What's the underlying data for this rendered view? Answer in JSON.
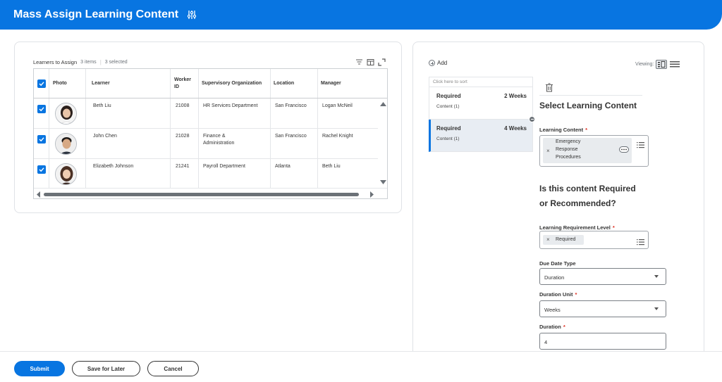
{
  "header": {
    "title": "Mass Assign Learning Content",
    "icon": "settings-sliders-icon"
  },
  "learners": {
    "title": "Learners to Assign",
    "count": "3 items",
    "selected": "3 selected",
    "columns": [
      "Photo",
      "Learner",
      "Worker ID",
      "Supervisory Organization",
      "Location",
      "Manager"
    ],
    "column_worker_line1": "Worker",
    "column_worker_line2": "ID",
    "rows": [
      {
        "learner": "Beth Liu",
        "worker_id": "21008",
        "org": "HR Services Department",
        "org2": "",
        "location": "San Francisco",
        "manager": "Logan McNeil"
      },
      {
        "learner": "John Chen",
        "worker_id": "21028",
        "org": "Finance &",
        "org2": "Administration",
        "location": "San Francisco",
        "manager": "Rachel Knight"
      },
      {
        "learner": "Elizabeth Johnson",
        "worker_id": "21241",
        "org": "Payroll Department",
        "org2": "",
        "location": "Atlanta",
        "manager": "Beth Liu"
      }
    ]
  },
  "content_list": {
    "add_label": "Add",
    "viewing_label": "Viewing:",
    "sort_hint": "Click here to sort",
    "items": [
      {
        "level": "Required",
        "duration": "2 Weeks",
        "sub": "Content (1)"
      },
      {
        "level": "Required",
        "duration": "4 Weeks",
        "sub": "Content (1)"
      }
    ]
  },
  "detail": {
    "section_title": "Select Learning Content",
    "learning_content_label": "Learning Content",
    "learning_content_value_l1": "Emergency",
    "learning_content_value_l2": "Response",
    "learning_content_value_l3": "Procedures",
    "question_l1": "Is this content Required",
    "question_l2": "or Recommended?",
    "requirement_label": "Learning Requirement Level",
    "requirement_value": "Required",
    "due_date_type_label": "Due Date Type",
    "due_date_type_value": "Duration",
    "duration_unit_label": "Duration Unit",
    "duration_unit_value": "Weeks",
    "duration_label": "Duration",
    "duration_value": "4",
    "required_mark": "*"
  },
  "footer": {
    "submit": "Submit",
    "save_later": "Save for Later",
    "cancel": "Cancel"
  },
  "colors": {
    "brand": "#0875e1",
    "required": "#de2e21"
  }
}
